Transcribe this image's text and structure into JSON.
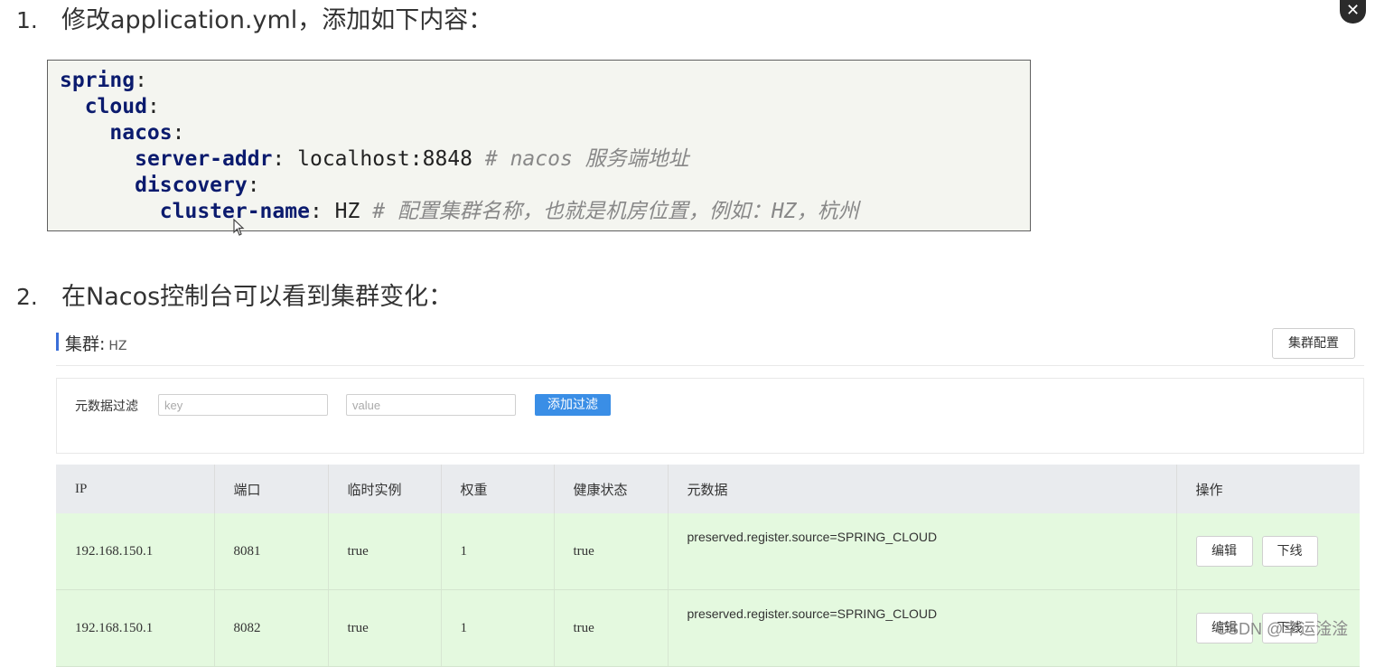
{
  "steps": {
    "step1": {
      "num": "1.",
      "text": "修改application.yml，添加如下内容："
    },
    "step2": {
      "num": "2.",
      "text": "在Nacos控制台可以看到集群变化："
    }
  },
  "close_label": "✕",
  "code": {
    "line1": {
      "key": "spring",
      "punct": ":"
    },
    "line2": {
      "key": "cloud",
      "punct": ":"
    },
    "line3": {
      "key": "nacos",
      "punct": ":"
    },
    "line4": {
      "key": "server-addr",
      "punct": ":",
      "value": "localhost:8848",
      "comment": "# nacos 服务端地址"
    },
    "line5": {
      "key": "discovery",
      "punct": ":"
    },
    "line6": {
      "key": "cluster-name",
      "punct": ":",
      "value": "HZ",
      "comment": "# 配置集群名称，也就是机房位置，例如：HZ，杭州"
    }
  },
  "cluster": {
    "label": "集群:",
    "name": "HZ",
    "config_button": "集群配置"
  },
  "filter": {
    "label": "元数据过滤",
    "key_placeholder": "key",
    "value_placeholder": "value",
    "add_button": "添加过滤"
  },
  "table": {
    "headers": [
      "IP",
      "端口",
      "临时实例",
      "权重",
      "健康状态",
      "元数据",
      "操作"
    ],
    "rows": [
      {
        "ip": "192.168.150.1",
        "port": "8081",
        "ephemeral": "true",
        "weight": "1",
        "healthy": "true",
        "metadata": "preserved.register.source=SPRING_CLOUD",
        "edit": "编辑",
        "offline": "下线"
      },
      {
        "ip": "192.168.150.1",
        "port": "8082",
        "ephemeral": "true",
        "weight": "1",
        "healthy": "true",
        "metadata": "preserved.register.source=SPRING_CLOUD",
        "edit": "编辑",
        "offline": "下线"
      }
    ]
  },
  "watermark": "CSDN @幸运淦淦",
  "colors": {
    "accent": "#3a8ee6",
    "keyword": "#0b1b6e",
    "row_bg": "#e4f9df",
    "header_bg": "#e9ebee"
  }
}
